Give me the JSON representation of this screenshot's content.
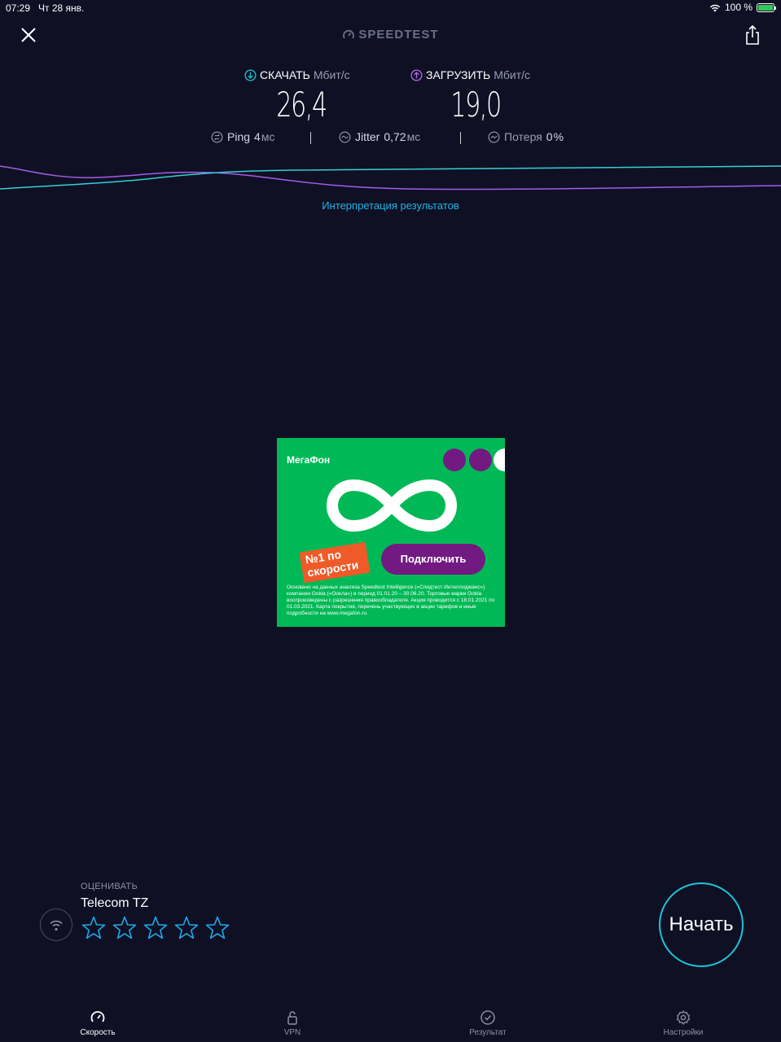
{
  "status": {
    "time": "07:29",
    "date": "Чт 28 янв.",
    "battery": "100 %"
  },
  "header": {
    "brand": "SPEEDTEST"
  },
  "download": {
    "label": "СКАЧАТЬ",
    "unit": "Мбит/с",
    "value": "26,4",
    "icon": "download-arrow-icon",
    "color": "#1cc5d6"
  },
  "upload": {
    "label": "ЗАГРУЗИТЬ",
    "unit": "Мбит/с",
    "value": "19,0",
    "icon": "upload-arrow-icon",
    "color": "#b665f0"
  },
  "stats": {
    "ping": {
      "label": "Ping",
      "value": "4",
      "unit": "мс"
    },
    "jitter": {
      "label": "Jitter",
      "value": "0,72",
      "unit": "мс"
    },
    "loss": {
      "label": "Потеря",
      "value": "0",
      "unit": "%"
    }
  },
  "interpretation_link": "Интерпретация результатов",
  "ad": {
    "brand": "МегаФон",
    "badge_line1": "№1 по",
    "badge_line2": "скорости",
    "button": "Подключить",
    "fine_print": "Основано на данных анализа Speedtest Intelligence («Спидтест Интеллиджанс») компании Ookla («Оокла») в период 01.01.20 – 30.06.20. Торговые марки Ookla воспроизведены с разрешения правообладателя. Акция проводится с 18.01.2021 по 01.03.2021. Карта покрытия, перечень участвующих в акции тарифов и иные подробности на www.megafon.ru.",
    "colors": {
      "green": "#00b956",
      "purple": "#731982",
      "orange": "#f05a28"
    }
  },
  "rating": {
    "label": "ОЦЕНИВАТЬ",
    "provider": "Telecom TZ",
    "stars": 5
  },
  "start_button": "Начать",
  "tabs": [
    {
      "label": "Скорость",
      "icon": "speedometer-icon",
      "active": true
    },
    {
      "label": "VPN",
      "icon": "unlock-icon",
      "active": false
    },
    {
      "label": "Результат",
      "icon": "checkmark-circle-icon",
      "active": false
    },
    {
      "label": "Настройки",
      "icon": "gear-icon",
      "active": false
    }
  ]
}
